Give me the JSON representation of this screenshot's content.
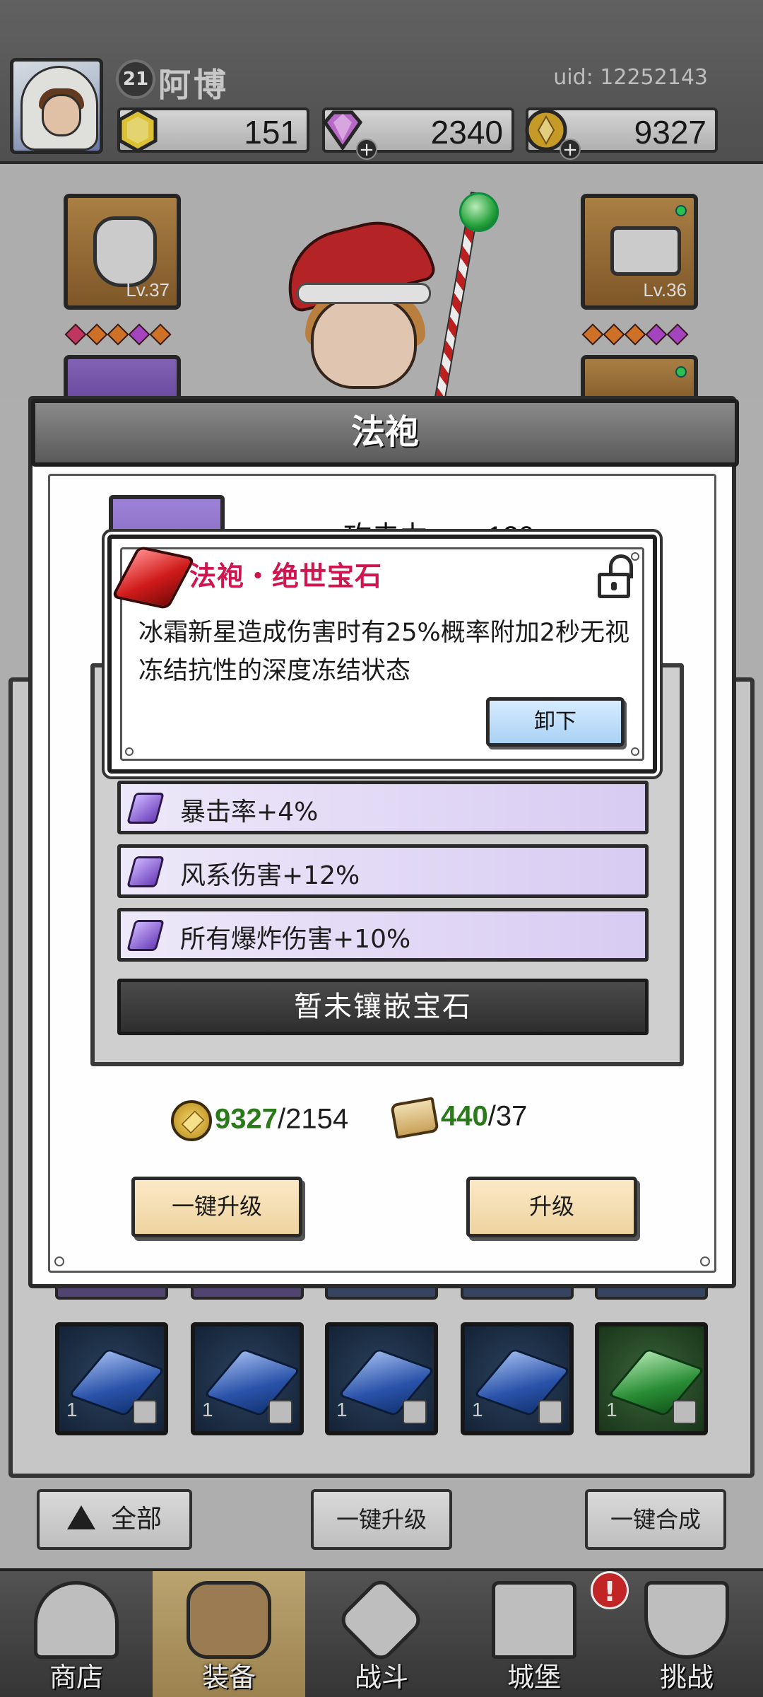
{
  "header": {
    "player_level": "21",
    "player_name": "阿博",
    "uid": "uid: 12252143",
    "resources": [
      {
        "name": "gold-gem",
        "value": "151"
      },
      {
        "name": "diamond",
        "value": "2340"
      },
      {
        "name": "coin",
        "value": "9327"
      }
    ],
    "plus": "+"
  },
  "equipment": {
    "left_slot_level": "Lv.37",
    "right_slot_level": "Lv.36"
  },
  "modal": {
    "title": "法袍",
    "attack_label": "攻击力:",
    "attack_value": "120",
    "gem_popup": {
      "title": "法袍・绝世宝石",
      "description": "冰霜新星造成伤害时有25%概率附加2秒无视冻结抗性的深度冻结状态",
      "unequip_label": "卸下"
    },
    "attributes": [
      {
        "label": "暴击率+4%"
      },
      {
        "label": "风系伤害+12%"
      },
      {
        "label": "所有爆炸伤害+10%"
      }
    ],
    "no_gem_label": "暂未镶嵌宝石",
    "cost": {
      "coin_have": "9327",
      "coin_need": "/2154",
      "scroll_have": "440",
      "scroll_need": "/37"
    },
    "upgrade_all_label": "一键升级",
    "upgrade_label": "升级"
  },
  "inventory": {
    "gem_counts": [
      "1",
      "1",
      "1",
      "1",
      "1"
    ]
  },
  "bottom_buttons": {
    "all_label": "全部",
    "upgrade_all_label": "一键升级",
    "merge_all_label": "一键合成"
  },
  "nav": {
    "items": [
      {
        "label": "商店"
      },
      {
        "label": "装备"
      },
      {
        "label": "战斗"
      },
      {
        "label": "城堡"
      },
      {
        "label": "挑战"
      }
    ],
    "badge": "!"
  }
}
